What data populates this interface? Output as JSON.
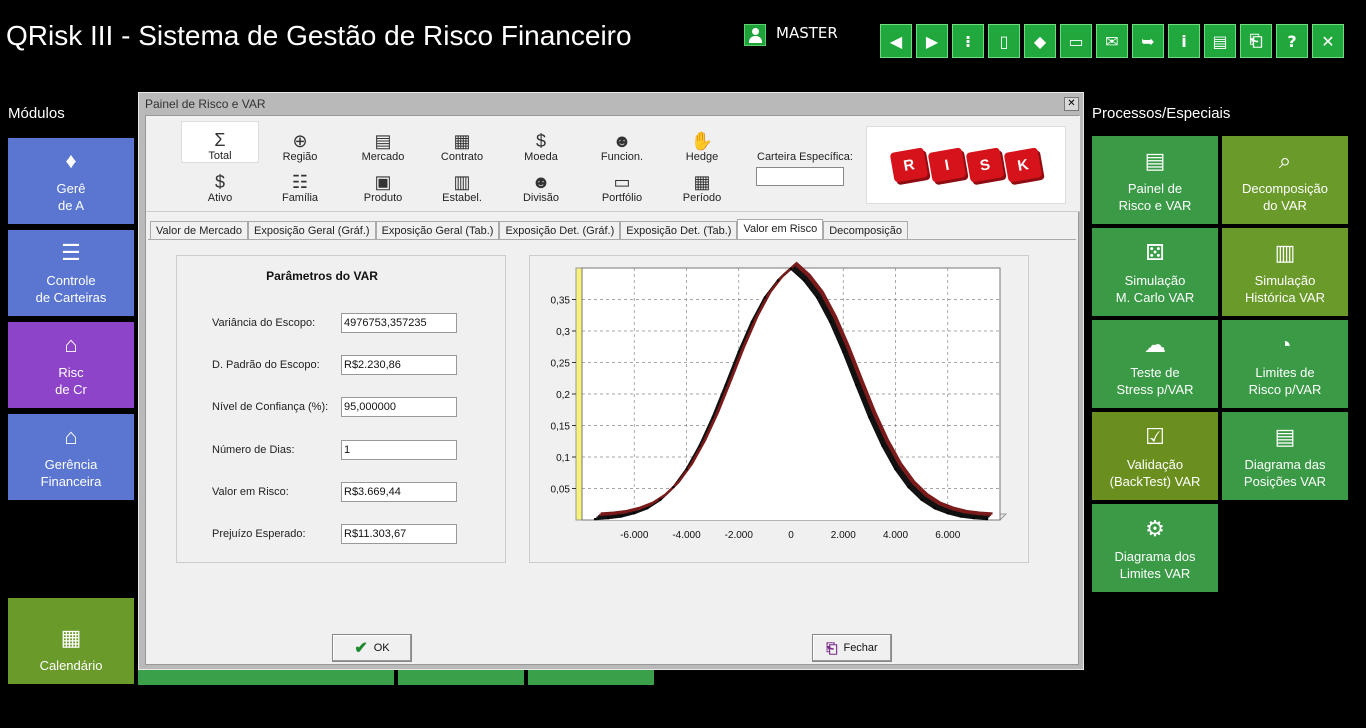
{
  "app": {
    "title": "QRisk III - Sistema de Gestão de Risco Financeiro",
    "user": "MASTER"
  },
  "toolbar": [
    {
      "name": "back",
      "glyph": "◀"
    },
    {
      "name": "forward",
      "glyph": "▶"
    },
    {
      "name": "traffic-light",
      "glyph": "⁝"
    },
    {
      "name": "column",
      "glyph": "▯"
    },
    {
      "name": "paint-bucket",
      "glyph": "◆"
    },
    {
      "name": "monitor",
      "glyph": "▭"
    },
    {
      "name": "envelope-check",
      "glyph": "✉"
    },
    {
      "name": "send-mail",
      "glyph": "➥"
    },
    {
      "name": "info",
      "glyph": "i"
    },
    {
      "name": "document-settings",
      "glyph": "▤"
    },
    {
      "name": "exit-door",
      "glyph": "⎗"
    },
    {
      "name": "help",
      "glyph": "?"
    },
    {
      "name": "close",
      "glyph": "✕"
    }
  ],
  "modules": {
    "label": "Módulos",
    "tiles": [
      {
        "lines": [
          "Gerê",
          "de A"
        ],
        "glyph": "♦"
      },
      {
        "lines": [
          "Controle",
          "de Carteiras"
        ],
        "glyph": "☰"
      },
      {
        "lines": [
          "Risc",
          "de  Cr"
        ],
        "glyph": "⌂"
      },
      {
        "lines": [
          "Gerência",
          "Financeira"
        ],
        "glyph": "⌂"
      },
      {
        "lines": [
          "Calendário"
        ],
        "glyph": "▦"
      }
    ]
  },
  "processos": {
    "label": "Processos/Especiais",
    "tiles": [
      {
        "lines": [
          "Painel de",
          "Risco e VAR"
        ],
        "glyph": "▤"
      },
      {
        "lines": [
          "Decomposição",
          "do VAR"
        ],
        "glyph": "⌕"
      },
      {
        "lines": [
          "Simulação",
          "M. Carlo VAR"
        ],
        "glyph": "⚄"
      },
      {
        "lines": [
          "Simulação",
          "Histórica VAR"
        ],
        "glyph": "▥"
      },
      {
        "lines": [
          "Teste de",
          "Stress p/VAR"
        ],
        "glyph": "☁"
      },
      {
        "lines": [
          "Limites de",
          "Risco p/VAR"
        ],
        "glyph": "◔"
      },
      {
        "lines": [
          "Validação",
          "(BackTest) VAR"
        ],
        "glyph": "☑"
      },
      {
        "lines": [
          "Diagrama das",
          "Posições VAR"
        ],
        "glyph": "▤"
      },
      {
        "lines": [
          "Diagrama dos",
          "Limites VAR"
        ],
        "glyph": "⚙"
      }
    ]
  },
  "dialog": {
    "title": "Painel de Risco e VAR",
    "filters": [
      {
        "label": "Total",
        "glyph": "Σ"
      },
      {
        "label": "Região",
        "glyph": "⊕"
      },
      {
        "label": "Mercado",
        "glyph": "▤"
      },
      {
        "label": "Contrato",
        "glyph": "▦"
      },
      {
        "label": "Moeda",
        "glyph": "$"
      },
      {
        "label": "Funcion.",
        "glyph": "☻"
      },
      {
        "label": "Hedge",
        "glyph": "✋"
      },
      {
        "label": "Ativo",
        "glyph": "$"
      },
      {
        "label": "Família",
        "glyph": "☷"
      },
      {
        "label": "Produto",
        "glyph": "▣"
      },
      {
        "label": "Estabel.",
        "glyph": "▥"
      },
      {
        "label": "Divisão",
        "glyph": "☻"
      },
      {
        "label": "Portfólio",
        "glyph": "▭"
      },
      {
        "label": "Período",
        "glyph": "▦"
      }
    ],
    "carteira_label": "Carteira Específica:",
    "carteira_value": "",
    "logo_letters": [
      "R",
      "I",
      "S",
      "K"
    ],
    "tabs": [
      "Valor de Mercado",
      "Exposição Geral (Gráf.)",
      "Exposição Geral (Tab.)",
      "Exposição Det. (Gráf.)",
      "Exposição Det. (Tab.)",
      "Valor em Risco",
      "Decomposição"
    ],
    "active_tab": 5,
    "params": {
      "title": "Parâmetros do VAR",
      "rows": [
        {
          "label": "Variância do Escopo:",
          "value": "4976753,357235"
        },
        {
          "label": "D. Padrão do Escopo:",
          "value": "R$2.230,86"
        },
        {
          "label": "Nível de Confiança (%):",
          "value": "95,000000"
        },
        {
          "label": "Número de Dias:",
          "value": "1"
        },
        {
          "label": "Valor em Risco:",
          "value": "R$3.669,44"
        },
        {
          "label": "Prejuízo Esperado:",
          "value": "R$11.303,67"
        }
      ]
    },
    "ok_label": "OK",
    "close_label": "Fechar"
  },
  "chart_data": {
    "type": "area",
    "xlim": [
      -8000,
      8000
    ],
    "ylim": [
      0,
      0.4
    ],
    "xticks": [
      -6000,
      -4000,
      -2000,
      0,
      2000,
      4000,
      6000
    ],
    "xtick_labels": [
      "-6.000",
      "-4.000",
      "-2.000",
      "0",
      "2.000",
      "4.000",
      "6.000"
    ],
    "yticks": [
      0.05,
      0.1,
      0.15,
      0.2,
      0.25,
      0.3,
      0.35
    ],
    "ytick_labels": [
      "0,05",
      "0,1",
      "0,15",
      "0,2",
      "0,25",
      "0,3",
      "0,35"
    ],
    "grid": true,
    "x": [
      -7500,
      -7000,
      -6500,
      -6000,
      -5500,
      -5000,
      -4500,
      -4000,
      -3500,
      -3000,
      -2500,
      -2000,
      -1500,
      -1000,
      -500,
      0,
      500,
      1000,
      1500,
      2000,
      2500,
      3000,
      3500,
      4000,
      4500,
      5000,
      5500,
      6000,
      6500,
      7000,
      7500
    ],
    "y": [
      0.0014,
      0.0029,
      0.0055,
      0.0107,
      0.0187,
      0.0322,
      0.0521,
      0.0806,
      0.1178,
      0.1628,
      0.2142,
      0.2669,
      0.3145,
      0.3532,
      0.3802,
      0.3989,
      0.3802,
      0.3532,
      0.3145,
      0.2669,
      0.2142,
      0.1628,
      0.1178,
      0.0806,
      0.0521,
      0.0322,
      0.0187,
      0.0107,
      0.0055,
      0.0029,
      0.0014
    ]
  }
}
